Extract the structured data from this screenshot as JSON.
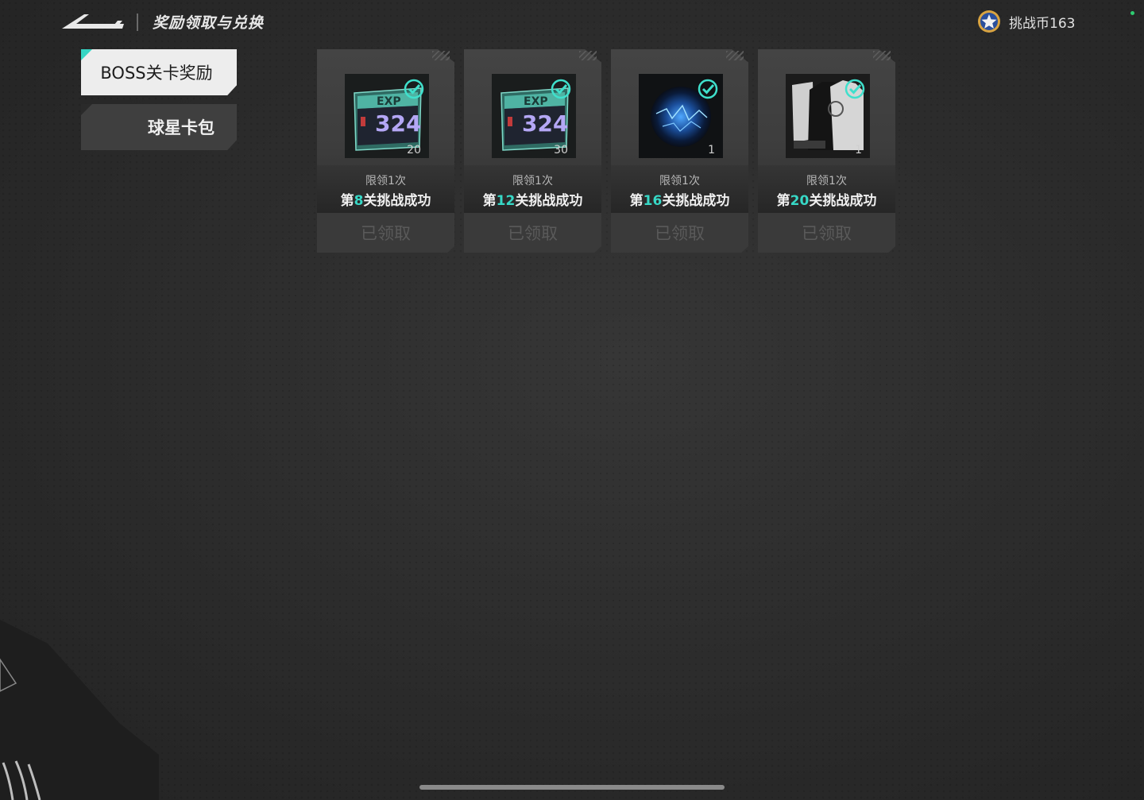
{
  "header": {
    "title": "奖励领取与兑换",
    "currency_label": "挑战币163"
  },
  "sidebar": {
    "tabs": [
      {
        "label": "BOSS关卡奖励",
        "active": true
      },
      {
        "label": "球星卡包",
        "active": false
      }
    ]
  },
  "rewards": [
    {
      "item": "exp-card",
      "exp_value": "324",
      "exp_tag": "EXP",
      "count": "20",
      "limit": "限领1次",
      "stage_prefix": "第",
      "stage_num": "8",
      "stage_suffix": "关挑战成功",
      "button": "已领取"
    },
    {
      "item": "exp-card",
      "exp_value": "324",
      "exp_tag": "EXP",
      "count": "30",
      "limit": "限领1次",
      "stage_prefix": "第",
      "stage_num": "12",
      "stage_suffix": "关挑战成功",
      "button": "已领取"
    },
    {
      "item": "energy-orb",
      "count": "1",
      "limit": "限领1次",
      "stage_prefix": "第",
      "stage_num": "16",
      "stage_suffix": "关挑战成功",
      "button": "已领取"
    },
    {
      "item": "uniform",
      "count": "1",
      "limit": "限领1次",
      "stage_prefix": "第",
      "stage_num": "20",
      "stage_suffix": "关挑战成功",
      "button": "已领取"
    }
  ],
  "colors": {
    "accent": "#37d8c6",
    "background": "#2b2b2b",
    "tab_active": "#ededed",
    "disabled_text": "#5a5a5a"
  }
}
